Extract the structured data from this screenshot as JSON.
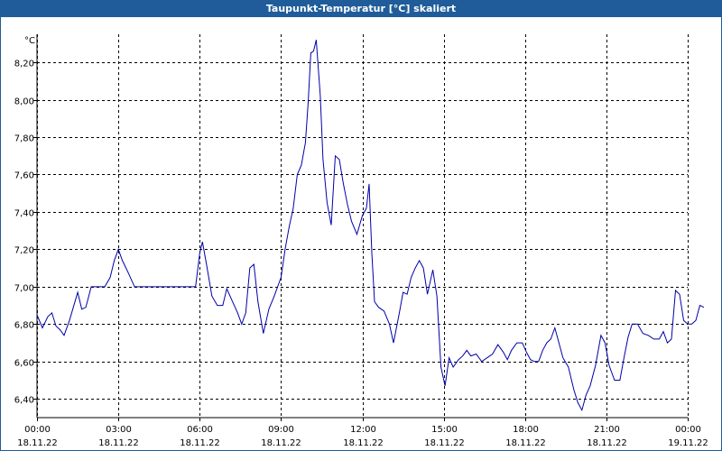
{
  "window": {
    "title": "Taupunkt-Temperatur [°C] skaliert"
  },
  "colors": {
    "title_bar": "#1f5c99",
    "series": "#0000aa",
    "grid": "#000000"
  },
  "chart_data": {
    "type": "line",
    "title": "Taupunkt-Temperatur [°C] skaliert",
    "ylabel": "°C",
    "xlabel": "",
    "grid": true,
    "ylim": [
      6.3,
      8.35
    ],
    "xlim": [
      0,
      24
    ],
    "y_ticks": [
      {
        "value": 6.4,
        "label": "6,40"
      },
      {
        "value": 6.6,
        "label": "6,60"
      },
      {
        "value": 6.8,
        "label": "6,80"
      },
      {
        "value": 7.0,
        "label": "7,00"
      },
      {
        "value": 7.2,
        "label": "7,20"
      },
      {
        "value": 7.4,
        "label": "7,40"
      },
      {
        "value": 7.6,
        "label": "7,60"
      },
      {
        "value": 7.8,
        "label": "7,80"
      },
      {
        "value": 8.0,
        "label": "8,00"
      },
      {
        "value": 8.2,
        "label": "8,20"
      }
    ],
    "x_ticks": [
      {
        "value": 0,
        "time": "00:00",
        "date": "18.11.22"
      },
      {
        "value": 3,
        "time": "03:00",
        "date": "18.11.22"
      },
      {
        "value": 6,
        "time": "06:00",
        "date": "18.11.22"
      },
      {
        "value": 9,
        "time": "09:00",
        "date": "18.11.22"
      },
      {
        "value": 12,
        "time": "12:00",
        "date": "18.11.22"
      },
      {
        "value": 15,
        "time": "15:00",
        "date": "18.11.22"
      },
      {
        "value": 18,
        "time": "18:00",
        "date": "18.11.22"
      },
      {
        "value": 21,
        "time": "21:00",
        "date": "18.11.22"
      },
      {
        "value": 24,
        "time": "00:00",
        "date": "19.11.22"
      }
    ],
    "series": [
      {
        "points": [
          [
            0.0,
            6.85
          ],
          [
            0.2,
            6.78
          ],
          [
            0.4,
            6.84
          ],
          [
            0.55,
            6.86
          ],
          [
            0.7,
            6.79
          ],
          [
            0.85,
            6.77
          ],
          [
            1.0,
            6.74
          ],
          [
            1.2,
            6.82
          ],
          [
            1.5,
            6.97
          ],
          [
            1.65,
            6.88
          ],
          [
            1.8,
            6.89
          ],
          [
            2.0,
            7.0
          ],
          [
            2.3,
            7.0
          ],
          [
            2.5,
            7.0
          ],
          [
            2.7,
            7.05
          ],
          [
            2.85,
            7.14
          ],
          [
            3.0,
            7.2
          ],
          [
            3.15,
            7.14
          ],
          [
            3.35,
            7.08
          ],
          [
            3.6,
            7.0
          ],
          [
            4.0,
            7.0
          ],
          [
            5.0,
            7.0
          ],
          [
            5.7,
            7.0
          ],
          [
            5.85,
            7.0
          ],
          [
            6.0,
            7.18
          ],
          [
            6.1,
            7.24
          ],
          [
            6.25,
            7.12
          ],
          [
            6.45,
            6.95
          ],
          [
            6.65,
            6.9
          ],
          [
            6.85,
            6.9
          ],
          [
            7.0,
            6.99
          ],
          [
            7.15,
            6.94
          ],
          [
            7.4,
            6.86
          ],
          [
            7.55,
            6.8
          ],
          [
            7.7,
            6.86
          ],
          [
            7.85,
            7.1
          ],
          [
            8.0,
            7.12
          ],
          [
            8.15,
            6.92
          ],
          [
            8.35,
            6.75
          ],
          [
            8.55,
            6.88
          ],
          [
            8.75,
            6.95
          ],
          [
            9.0,
            7.05
          ],
          [
            9.15,
            7.2
          ],
          [
            9.3,
            7.32
          ],
          [
            9.45,
            7.42
          ],
          [
            9.6,
            7.6
          ],
          [
            9.75,
            7.65
          ],
          [
            9.9,
            7.77
          ],
          [
            10.0,
            7.98
          ],
          [
            10.1,
            8.25
          ],
          [
            10.2,
            8.26
          ],
          [
            10.3,
            8.32
          ],
          [
            10.45,
            8.02
          ],
          [
            10.55,
            7.68
          ],
          [
            10.7,
            7.45
          ],
          [
            10.85,
            7.33
          ],
          [
            11.0,
            7.7
          ],
          [
            11.15,
            7.68
          ],
          [
            11.3,
            7.55
          ],
          [
            11.45,
            7.44
          ],
          [
            11.6,
            7.35
          ],
          [
            11.8,
            7.28
          ],
          [
            12.0,
            7.38
          ],
          [
            12.15,
            7.42
          ],
          [
            12.25,
            7.55
          ],
          [
            12.35,
            7.18
          ],
          [
            12.45,
            6.92
          ],
          [
            12.6,
            6.89
          ],
          [
            12.8,
            6.87
          ],
          [
            13.0,
            6.8
          ],
          [
            13.15,
            6.7
          ],
          [
            13.35,
            6.85
          ],
          [
            13.5,
            6.97
          ],
          [
            13.65,
            6.96
          ],
          [
            13.8,
            7.05
          ],
          [
            13.95,
            7.1
          ],
          [
            14.1,
            7.14
          ],
          [
            14.25,
            7.1
          ],
          [
            14.4,
            6.96
          ],
          [
            14.6,
            7.09
          ],
          [
            14.75,
            6.95
          ],
          [
            14.9,
            6.57
          ],
          [
            15.05,
            6.47
          ],
          [
            15.2,
            6.62
          ],
          [
            15.35,
            6.57
          ],
          [
            15.55,
            6.61
          ],
          [
            15.7,
            6.63
          ],
          [
            15.85,
            6.66
          ],
          [
            16.0,
            6.63
          ],
          [
            16.2,
            6.64
          ],
          [
            16.4,
            6.6
          ],
          [
            16.6,
            6.62
          ],
          [
            16.8,
            6.64
          ],
          [
            17.0,
            6.69
          ],
          [
            17.2,
            6.65
          ],
          [
            17.35,
            6.61
          ],
          [
            17.5,
            6.66
          ],
          [
            17.7,
            6.7
          ],
          [
            17.9,
            6.7
          ],
          [
            18.05,
            6.65
          ],
          [
            18.2,
            6.61
          ],
          [
            18.35,
            6.6
          ],
          [
            18.5,
            6.6
          ],
          [
            18.65,
            6.66
          ],
          [
            18.8,
            6.7
          ],
          [
            18.95,
            6.72
          ],
          [
            19.1,
            6.78
          ],
          [
            19.25,
            6.7
          ],
          [
            19.4,
            6.62
          ],
          [
            19.6,
            6.57
          ],
          [
            19.8,
            6.45
          ],
          [
            19.95,
            6.38
          ],
          [
            20.1,
            6.34
          ],
          [
            20.25,
            6.42
          ],
          [
            20.4,
            6.47
          ],
          [
            20.6,
            6.58
          ],
          [
            20.8,
            6.74
          ],
          [
            20.95,
            6.7
          ],
          [
            21.1,
            6.58
          ],
          [
            21.3,
            6.5
          ],
          [
            21.5,
            6.5
          ],
          [
            21.65,
            6.62
          ],
          [
            21.8,
            6.73
          ],
          [
            21.95,
            6.8
          ],
          [
            22.15,
            6.8
          ],
          [
            22.35,
            6.75
          ],
          [
            22.55,
            6.74
          ],
          [
            22.75,
            6.72
          ],
          [
            22.95,
            6.72
          ],
          [
            23.1,
            6.76
          ],
          [
            23.25,
            6.7
          ],
          [
            23.4,
            6.72
          ],
          [
            23.55,
            6.98
          ],
          [
            23.7,
            6.96
          ],
          [
            23.85,
            6.82
          ],
          [
            24.0,
            6.8
          ],
          [
            24.15,
            6.8
          ],
          [
            24.3,
            6.82
          ],
          [
            24.45,
            6.9
          ],
          [
            24.6,
            6.89
          ]
        ]
      }
    ]
  }
}
